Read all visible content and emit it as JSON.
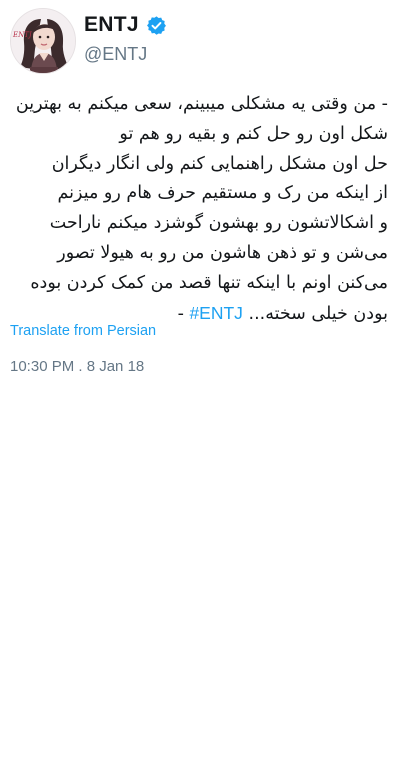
{
  "author": {
    "display_name": "ENTJ",
    "handle": "@ENTJ",
    "verified": true,
    "avatar_icon": "profile-portrait-icon",
    "avatar_text": "ENTJ"
  },
  "tweet": {
    "lines": [
      "- من وقتی یه مشکلی میبینم، سعی میکنم به بهترین",
      "شکل اون رو حل کنم و بقیه رو هم تو",
      "حل اون مشکل راهنمایی کنم ولی انگار دیگران",
      "از اینکه من رک و مستقیم حرف هام رو میزنم",
      "و اشکالاتشون رو بهشون گوشزد میکنم ناراحت",
      "می‌شن و تو ذهن هاشون من رو به هیولا تصور",
      "می‌کنن اونم با اینکه تنها قصد من کمک کردن بوده",
      "بودن خیلی سخته..."
    ],
    "hashtag": "#ENTJ",
    "last_line_suffix": " -"
  },
  "translate_label": "Translate from Persian",
  "timestamp": "10:30 PM . 8 Jan 18",
  "colors": {
    "link": "#1da1f2",
    "secondary_text": "#657786",
    "primary_text": "#14171a",
    "verified_badge": "#1da1f2"
  }
}
